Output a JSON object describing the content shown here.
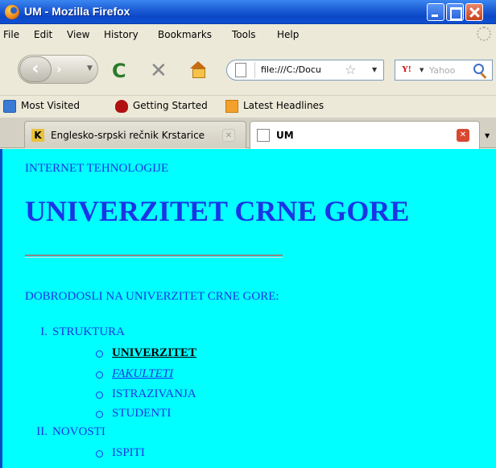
{
  "window": {
    "title": "UM - Mozilla Firefox"
  },
  "menu": [
    "File",
    "Edit",
    "View",
    "History",
    "Bookmarks",
    "Tools",
    "Help"
  ],
  "navigation": {
    "url": "file:///C:/Docu",
    "search_placeholder": "Yahoo"
  },
  "bookmarks": [
    "Most Visited",
    "Getting Started",
    "Latest Headlines"
  ],
  "tabs": [
    {
      "label": "Englesko-srpski rečnik Krstarice",
      "active": false
    },
    {
      "label": "UM",
      "active": true
    }
  ],
  "page": {
    "background": "#00ffff",
    "text_color": "#1a35e6",
    "small_title": "INTERNET TEHNOLOGIJE",
    "heading": "UNIVERZITET CRNE GORE",
    "welcome": "DOBRODOSLI NA UNIVERZITET CRNE GORE:",
    "list": [
      {
        "number": "I.",
        "label": "STRUKTURA",
        "items": [
          "UNIVERZITET",
          "FAKULTETI",
          "ISTRAZIVANJA",
          "STUDENTI"
        ]
      },
      {
        "number": "II.",
        "label": "NOVOSTI",
        "items": [
          "ISPITI"
        ]
      }
    ]
  }
}
